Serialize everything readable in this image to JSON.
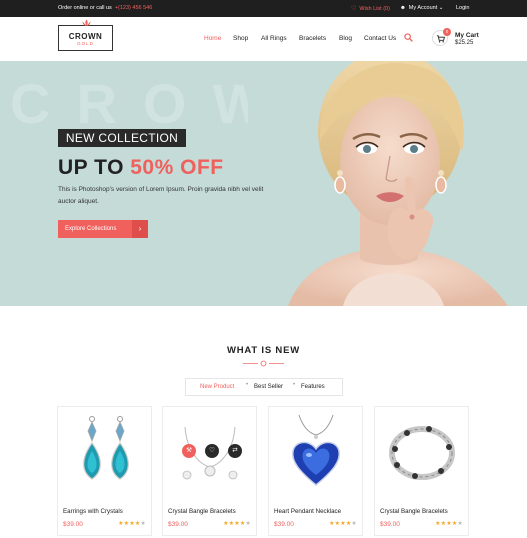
{
  "topbar": {
    "order_text": "Order online or call us",
    "phone": "+(123) 456 546",
    "wishlist": "Wish List (0)",
    "account": "My Account",
    "login": "Login"
  },
  "header": {
    "logo_main": "CROWN",
    "logo_sub": "GOLD",
    "nav": [
      "Home",
      "Shop",
      "All Rings",
      "Bracelets",
      "Blog",
      "Contact Us"
    ],
    "active_nav": "Home",
    "cart_count": "0",
    "cart_label": "My Cart",
    "cart_total": "$25.25"
  },
  "hero": {
    "bg_word": "CROWN",
    "badge": "NEW COLLECTION",
    "headline_prefix": "UP TO ",
    "headline_accent": "50% OFF",
    "blurb": "This is Photoshop's version  of Lorem Ipsum. Proin gravida nibh vel velit auctor aliquet.",
    "cta": "Explore Collections",
    "cta_icon": "arrow-right-icon"
  },
  "section": {
    "title": "WHAT IS NEW",
    "tabs": [
      "New Product",
      "Best Seller",
      "Features"
    ],
    "active_tab": "New Product"
  },
  "products": [
    {
      "name": "Earrings with Crystals",
      "price": "$39.00",
      "rating": 4,
      "image": "earrings-icon"
    },
    {
      "name": "Crystal Bangle Bracelets",
      "price": "$39.00",
      "rating": 4,
      "image": "necklace-icon"
    },
    {
      "name": "Heart Pendant Necklace",
      "price": "$39.00",
      "rating": 4,
      "image": "heart-pendant-icon"
    },
    {
      "name": "Crystal Bangle Bracelets",
      "price": "$39.00",
      "rating": 4,
      "image": "bracelet-icon"
    }
  ],
  "colors": {
    "accent": "#f0605d",
    "dark": "#1f1f1f",
    "hero_bg": "#c4dbd8",
    "star": "#f5a623"
  }
}
